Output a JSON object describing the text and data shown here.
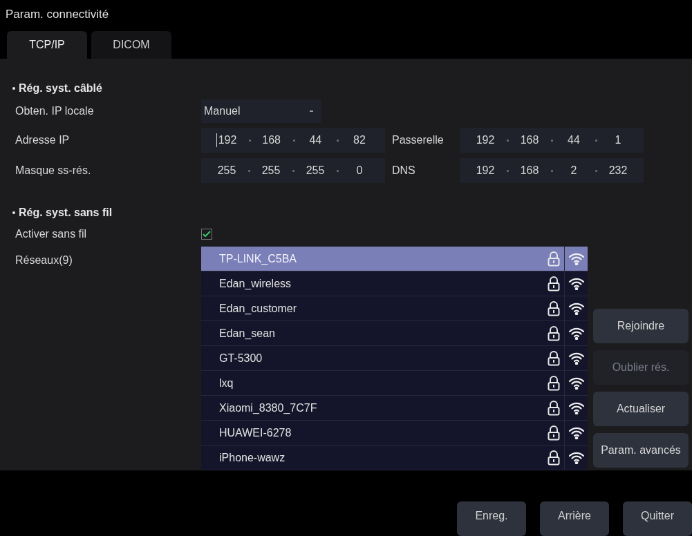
{
  "window": {
    "title": "Param. connectivité"
  },
  "tabs": [
    {
      "label": "TCP/IP",
      "selected": true
    },
    {
      "label": "DICOM",
      "selected": false
    }
  ],
  "wired": {
    "heading": "Rég. syst. câblé",
    "ip_mode": {
      "label": "Obten. IP locale",
      "value": "Manuel"
    },
    "ip_address": {
      "label": "Adresse IP",
      "octets": [
        "192",
        "168",
        "44",
        "82"
      ],
      "focused": true
    },
    "gateway": {
      "label": "Passerelle",
      "octets": [
        "192",
        "168",
        "44",
        "1"
      ]
    },
    "subnet_mask": {
      "label": "Masque ss-rés.",
      "octets": [
        "255",
        "255",
        "255",
        "0"
      ]
    },
    "dns": {
      "label": "DNS",
      "octets": [
        "192",
        "168",
        "2",
        "232"
      ]
    }
  },
  "wireless": {
    "heading": "Rég. syst. sans fil",
    "enable": {
      "label": "Activer sans fil",
      "checked": true
    },
    "networks_label": "Réseaux(9)",
    "networks": [
      {
        "name": "TP-LINK_C5BA",
        "selected": true
      },
      {
        "name": "Edan_wireless",
        "selected": false
      },
      {
        "name": "Edan_customer",
        "selected": false
      },
      {
        "name": "Edan_sean",
        "selected": false
      },
      {
        "name": "GT-5300",
        "selected": false
      },
      {
        "name": "lxq",
        "selected": false
      },
      {
        "name": "Xiaomi_8380_7C7F",
        "selected": false
      },
      {
        "name": "HUAWEI-6278",
        "selected": false
      },
      {
        "name": "iPhone-wawz",
        "selected": false
      }
    ],
    "side_buttons": [
      {
        "label": "Rejoindre",
        "disabled": false
      },
      {
        "label": "Oublier rés.",
        "disabled": true
      },
      {
        "label": "Actualiser",
        "disabled": false
      },
      {
        "label": "Param. avancés",
        "disabled": false
      }
    ]
  },
  "footer_buttons": [
    "Enreg.",
    "Arrière",
    "Quitter"
  ]
}
